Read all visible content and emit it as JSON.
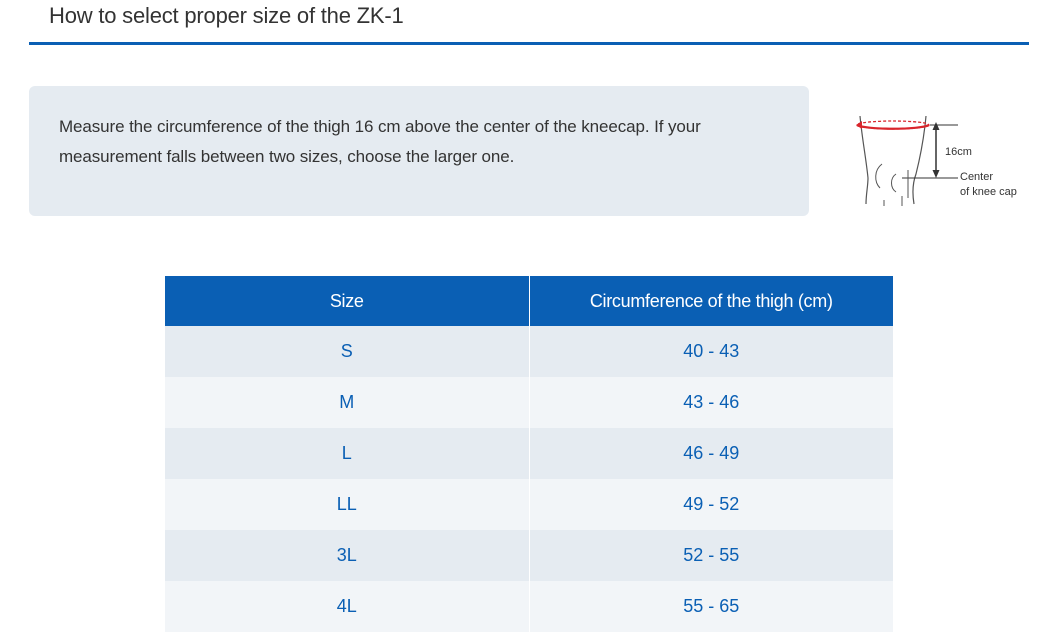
{
  "header": {
    "title": "How to select proper size of the ZK-1"
  },
  "note": {
    "line1": "Measure the circumference of the thigh 16 cm above the center of the kneecap. If your",
    "line2": "measurement falls between two sizes, choose the larger one."
  },
  "diagram": {
    "distance_label": "16cm",
    "center_label_line1": "Center",
    "center_label_line2": "of knee cap"
  },
  "table": {
    "columns": [
      "Size",
      "Circumference of the thigh (cm)"
    ],
    "rows": [
      [
        "S",
        "40 - 43"
      ],
      [
        "M",
        "43 - 46"
      ],
      [
        "L",
        "46 - 49"
      ],
      [
        "LL",
        "49 - 52"
      ],
      [
        "3L",
        "52 - 55"
      ],
      [
        "4L",
        "55 - 65"
      ]
    ]
  },
  "colors": {
    "accent": "#0a5fb4",
    "panel": "#e5ebf1",
    "row_alt": "#f2f5f8",
    "measure_line": "#d9262c"
  }
}
